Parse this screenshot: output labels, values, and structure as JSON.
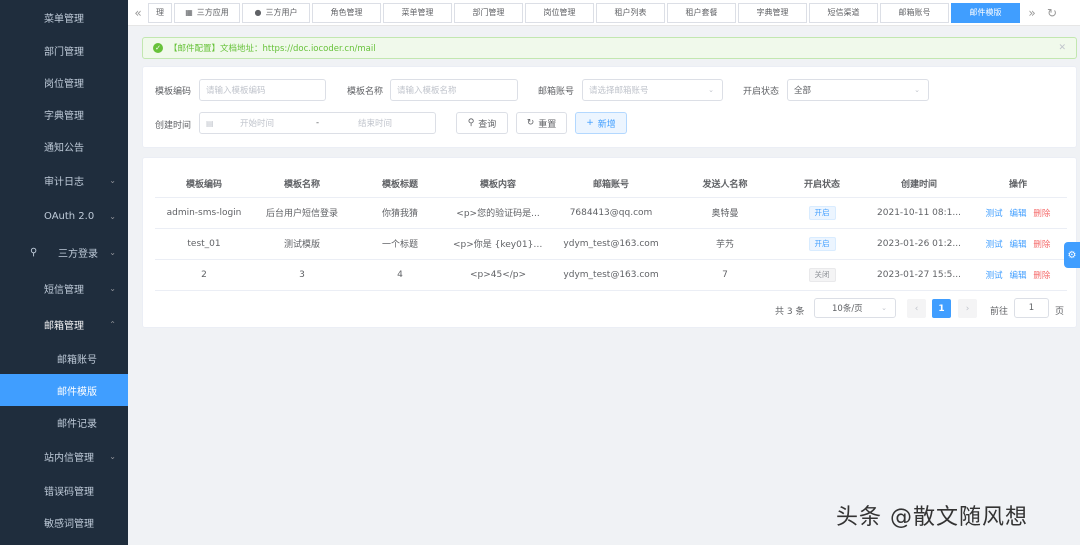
{
  "sidebar": {
    "items": [
      {
        "label": "菜单管理"
      },
      {
        "label": "部门管理"
      },
      {
        "label": "岗位管理"
      },
      {
        "label": "字典管理"
      },
      {
        "label": "通知公告"
      },
      {
        "label": "审计日志"
      },
      {
        "label": "OAuth 2.0"
      },
      {
        "label": "三方登录"
      },
      {
        "label": "短信管理"
      },
      {
        "label": "邮箱管理"
      },
      {
        "label": "邮箱账号"
      },
      {
        "label": "邮件模版"
      },
      {
        "label": "邮件记录"
      },
      {
        "label": "站内信管理"
      },
      {
        "label": "错误码管理"
      },
      {
        "label": "敏感词管理"
      }
    ]
  },
  "tabs": {
    "items": [
      "理",
      "三方应用",
      "三方用户",
      "角色管理",
      "菜单管理",
      "部门管理",
      "岗位管理",
      "租户列表",
      "租户套餐",
      "字典管理",
      "短信渠道",
      "邮箱账号",
      "邮件模版"
    ],
    "active": "邮件模版"
  },
  "alert": {
    "text": "【邮件配置】文档地址：https://doc.iocoder.cn/mail"
  },
  "search": {
    "code_label": "模板编码",
    "code_placeholder": "请输入模板编码",
    "name_label": "模板名称",
    "name_placeholder": "请输入模板名称",
    "account_label": "邮箱账号",
    "account_placeholder": "请选择邮箱账号",
    "status_label": "开启状态",
    "status_value": "全部",
    "time_label": "创建时间",
    "start_placeholder": "开始时间",
    "range_sep": "-",
    "end_placeholder": "结束时间",
    "query_label": "查询",
    "reset_label": "重置",
    "add_label": "新增"
  },
  "table": {
    "headers": [
      "模板编码",
      "模板名称",
      "模板标题",
      "模板内容",
      "邮箱账号",
      "发送人名称",
      "开启状态",
      "创建时间",
      "操作"
    ],
    "rows": [
      [
        "admin-sms-login",
        "后台用户短信登录",
        "你猜我猜",
        "<p>您的验证码是...",
        "7684413@qq.com",
        "奥特曼",
        "开启",
        "2021-10-11 08:1..."
      ],
      [
        "test_01",
        "测试模版",
        "一个标题",
        "<p>你是 {key01} ...",
        "ydym_test@163.com",
        "芋艿",
        "开启",
        "2023-01-26 01:2..."
      ],
      [
        "2",
        "3",
        "4",
        "<p>45</p>",
        "ydym_test@163.com",
        "7",
        "关闭",
        "2023-01-27 15:5..."
      ]
    ],
    "op_test": "测试",
    "op_edit": "编辑",
    "op_delete": "删除"
  },
  "pagination": {
    "total": "共 3 条",
    "page_size": "10条/页",
    "current": "1",
    "goto_label": "前往",
    "goto_value": "1",
    "page_suffix": "页"
  },
  "watermark": "头条 @散文随风想",
  "colors": {
    "primary": "#409eff",
    "sidebar_bg": "#1f2d3d",
    "success": "#67c23a",
    "danger": "#f56c6c"
  }
}
